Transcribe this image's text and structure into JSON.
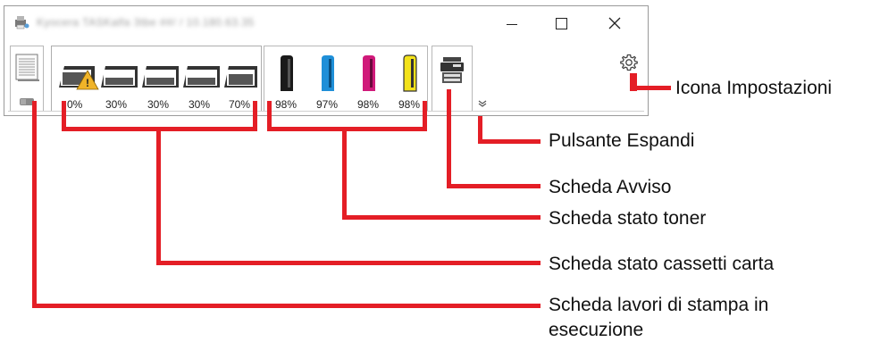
{
  "window": {
    "title": "Kyocera TASKalfa 3tbe ##/ / 10.180.63.35"
  },
  "cassettes": {
    "levels": [
      "0%",
      "30%",
      "30%",
      "30%",
      "70%"
    ],
    "warning_on_first": true
  },
  "toner": {
    "levels": [
      "98%",
      "97%",
      "98%",
      "98%"
    ],
    "colors": [
      "#1a1a1a",
      "#1f8fd8",
      "#d01a7a",
      "#f3e21a"
    ]
  },
  "callouts": {
    "settings_icon": "Icona Impostazioni",
    "expand_button": "Pulsante Espandi",
    "alert_tab": "Scheda Avviso",
    "toner_tab": "Scheda stato toner",
    "cassette_tab": "Scheda stato cassetti carta",
    "jobs_tab_line1": "Scheda lavori di stampa in",
    "jobs_tab_line2": "esecuzione"
  },
  "accent": "#e41e26"
}
